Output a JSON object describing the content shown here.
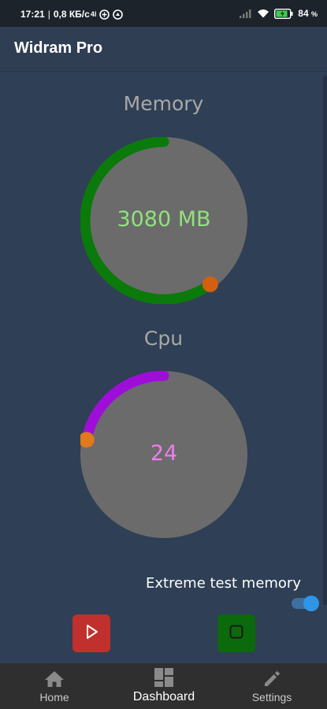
{
  "status_bar": {
    "time": "17:21",
    "network_speed": "0,8 КБ/с",
    "carrier_badge": "4l",
    "battery_percent": "84",
    "battery_unit": "%"
  },
  "app_bar": {
    "title": "Widram Pro"
  },
  "memory_gauge": {
    "label": "Memory",
    "value_text": "3080 MB",
    "progress_fraction": 0.6,
    "arc_color": "#0a7a0a",
    "value_color": "#8fe37a",
    "knob_color": "#d35f10"
  },
  "cpu_gauge": {
    "label": "Cpu",
    "value_text": "24",
    "progress_fraction": 0.22,
    "arc_color": "#9e0ed8",
    "value_color": "#ee7cf2",
    "knob_color": "#e07a1c"
  },
  "extreme_test": {
    "label": "Extreme test memory",
    "enabled": true
  },
  "actions": {
    "start_icon": "play-icon",
    "start_color": "#c0302d",
    "stop_icon": "stop-icon",
    "stop_color": "#0b6a0b"
  },
  "bottom_nav": {
    "items": [
      {
        "label": "Home",
        "icon": "home-icon"
      },
      {
        "label": "Dashboard",
        "icon": "dashboard-icon",
        "selected": true
      },
      {
        "label": "Settings",
        "icon": "pencil-icon"
      }
    ]
  }
}
